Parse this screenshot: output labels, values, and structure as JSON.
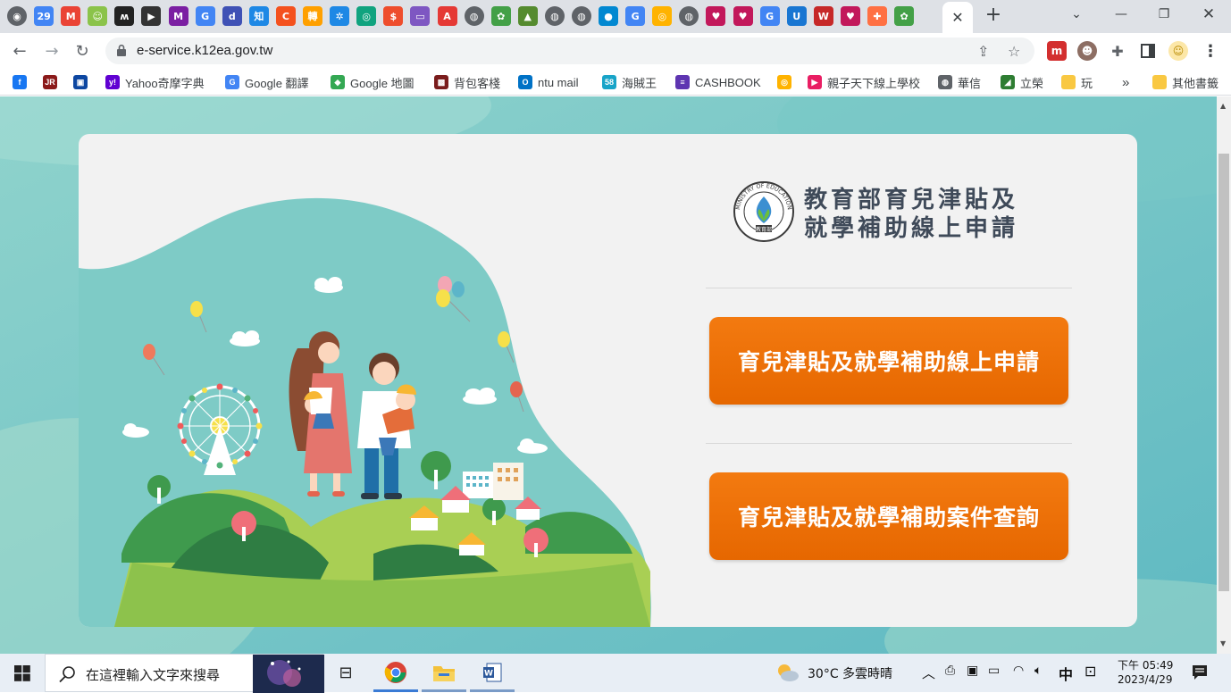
{
  "browser": {
    "url": "e-service.k12ea.gov.tw",
    "tab_close": "✕",
    "new_tab": "+",
    "tab_icons": [
      {
        "name": "chrome-icon",
        "color": "#5f6368",
        "glyph": "◉"
      },
      {
        "name": "calendar-icon",
        "color": "#4285f4",
        "glyph": "29"
      },
      {
        "name": "gmail-icon",
        "color": "#ea4335",
        "glyph": "M"
      },
      {
        "name": "line-icon",
        "color": "#8bc34a",
        "glyph": "☺"
      },
      {
        "name": "app-icon",
        "color": "#222222",
        "glyph": "ʍ"
      },
      {
        "name": "app-icon",
        "color": "#333333",
        "glyph": "▶"
      },
      {
        "name": "app-icon",
        "color": "#7b1fa2",
        "glyph": "M"
      },
      {
        "name": "google-icon",
        "color": "#4285f4",
        "glyph": "G"
      },
      {
        "name": "app-icon",
        "color": "#3f51b5",
        "glyph": "d"
      },
      {
        "name": "zhihu-icon",
        "color": "#1e88e5",
        "glyph": "知"
      },
      {
        "name": "app-icon",
        "color": "#f4511e",
        "glyph": "C"
      },
      {
        "name": "app-icon",
        "color": "#ffa000",
        "glyph": "轉"
      },
      {
        "name": "gear-icon",
        "color": "#1e88e5",
        "glyph": "✲"
      },
      {
        "name": "chatgpt-icon",
        "color": "#10a37f",
        "glyph": "◎"
      },
      {
        "name": "shopee-icon",
        "color": "#ee4d2d",
        "glyph": "$"
      },
      {
        "name": "app-icon",
        "color": "#7e57c2",
        "glyph": "▭"
      },
      {
        "name": "app-icon",
        "color": "#e53935",
        "glyph": "A"
      },
      {
        "name": "globe-icon",
        "color": "#5f6368",
        "glyph": "◍"
      },
      {
        "name": "app-icon",
        "color": "#43a047",
        "glyph": "✿"
      },
      {
        "name": "app-icon",
        "color": "#558b2f",
        "glyph": "▲"
      },
      {
        "name": "globe-icon",
        "color": "#5f6368",
        "glyph": "◍"
      },
      {
        "name": "globe-icon",
        "color": "#5f6368",
        "glyph": "◍"
      },
      {
        "name": "app-icon",
        "color": "#0288d1",
        "glyph": "●"
      },
      {
        "name": "google-icon",
        "color": "#4285f4",
        "glyph": "G"
      },
      {
        "name": "app-icon",
        "color": "#ffb300",
        "glyph": "◎"
      },
      {
        "name": "globe-icon",
        "color": "#5f6368",
        "glyph": "◍"
      },
      {
        "name": "heart-icon",
        "color": "#c2185b",
        "glyph": "♥"
      },
      {
        "name": "heart-icon",
        "color": "#c2185b",
        "glyph": "♥"
      },
      {
        "name": "google-icon",
        "color": "#4285f4",
        "glyph": "G"
      },
      {
        "name": "app-icon",
        "color": "#1976d2",
        "glyph": "U"
      },
      {
        "name": "app-icon",
        "color": "#c62828",
        "glyph": "W"
      },
      {
        "name": "heart-icon",
        "color": "#c2185b",
        "glyph": "♥"
      },
      {
        "name": "app-icon",
        "color": "#ff7043",
        "glyph": "✚"
      },
      {
        "name": "app-icon",
        "color": "#43a047",
        "glyph": "✿"
      }
    ],
    "window_controls": {
      "minimize": "—",
      "restore": "❐",
      "close": "✕"
    },
    "bookmarks": [
      {
        "label": "",
        "icon": "facebook-icon",
        "color": "#1877f2",
        "glyph": "f"
      },
      {
        "label": "",
        "icon": "jr-icon",
        "color": "#8b1a1a",
        "glyph": "JR"
      },
      {
        "label": "",
        "icon": "app-icon",
        "color": "#0d47a1",
        "glyph": "▣"
      },
      {
        "label": "Yahoo奇摩字典",
        "icon": "yahoo-icon",
        "color": "#6001d2",
        "glyph": "y!"
      },
      {
        "label": "Google 翻譯",
        "icon": "translate-icon",
        "color": "#4285f4",
        "glyph": "G"
      },
      {
        "label": "Google 地圖",
        "icon": "maps-icon",
        "color": "#34a853",
        "glyph": "◆"
      },
      {
        "label": "背包客棧",
        "icon": "app-icon",
        "color": "#7a1c1c",
        "glyph": "▩"
      },
      {
        "label": "ntu mail",
        "icon": "outlook-icon",
        "color": "#0072c6",
        "glyph": "O"
      },
      {
        "label": "海賊王",
        "icon": "app-icon",
        "color": "#18a4c8",
        "glyph": "58"
      },
      {
        "label": "CASHBOOK",
        "icon": "app-icon",
        "color": "#5e35b1",
        "glyph": "≡"
      },
      {
        "label": "",
        "icon": "app-icon",
        "color": "#ffb300",
        "glyph": "◎"
      },
      {
        "label": "親子天下線上學校",
        "icon": "youtube-icon",
        "color": "#e91e63",
        "glyph": "▶"
      },
      {
        "label": "華信",
        "icon": "globe-icon",
        "color": "#5f6368",
        "glyph": "◍"
      },
      {
        "label": "立榮",
        "icon": "app-icon",
        "color": "#2e7d32",
        "glyph": "◢"
      },
      {
        "label": "玩",
        "icon": "folder-icon",
        "color": "#f9c842",
        "glyph": ""
      }
    ],
    "bookmarks_more": "»",
    "other_bookmarks": "其他書籤"
  },
  "page": {
    "logo_alt": "MINISTRY OF EDUCATION",
    "logo_seal_text": "教育部",
    "title_line1": "教育部育兒津貼及",
    "title_line2": "就學補助線上申請",
    "button_apply": "育兒津貼及就學補助線上申請",
    "button_query": "育兒津貼及就學補助案件查詢"
  },
  "taskbar": {
    "search_placeholder": "在這裡輸入文字來搜尋",
    "weather": "30°C  多雲時晴",
    "ime": "中",
    "time": "下午 05:49",
    "date": "2023/4/29"
  }
}
